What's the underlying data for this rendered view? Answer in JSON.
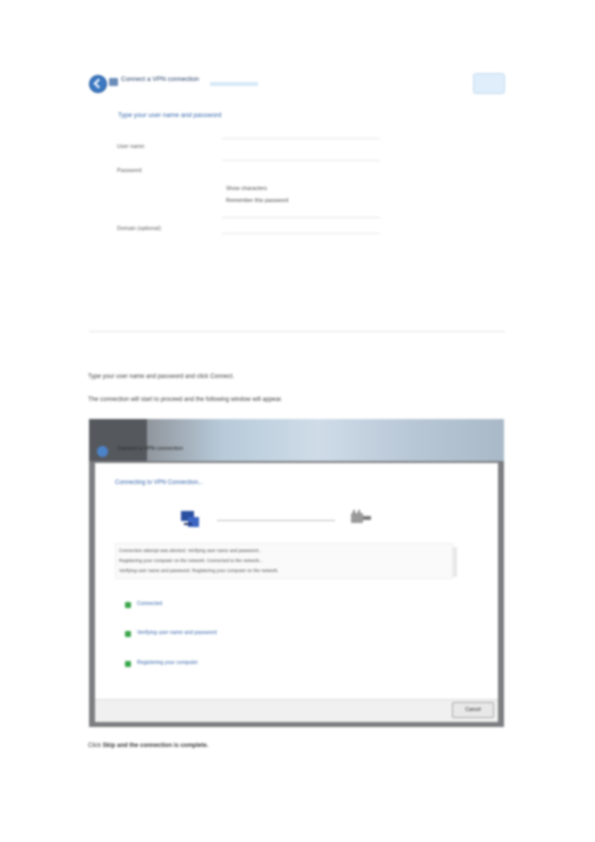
{
  "dialog": {
    "title": "Connect a VPN connection",
    "instruction": "Type your user name and password",
    "fields": [
      {
        "label": "User name:",
        "value": ""
      },
      {
        "label": "Password:",
        "value": ""
      },
      {
        "label": "Domain (optional):",
        "value": ""
      }
    ],
    "password_options": [
      "Show characters",
      "Remember this password"
    ]
  },
  "body": {
    "paragraph1": "Type your user name and password and click Connect.",
    "paragraph2": "The connection will start to proceed and the following window will appear."
  },
  "screenshot": {
    "title": "Connect a VPN connection",
    "connecting_text": "Connecting to VPN Connection...",
    "message_lines": [
      "Connection attempt was aborted. Verifying user name and password...",
      "Registering your computer on the network. Connected to the network...",
      "Verifying user name and password. Registering your computer on the network."
    ],
    "steps": [
      "Connected",
      "Verifying user name and password",
      "Registering your computer"
    ],
    "cancel_label": "Cancel"
  },
  "caption": {
    "prefix": "Click",
    "action": "Skip and the connection is complete."
  },
  "colors": {
    "accent": "#2e5fa8",
    "check": "#3aa64a"
  }
}
